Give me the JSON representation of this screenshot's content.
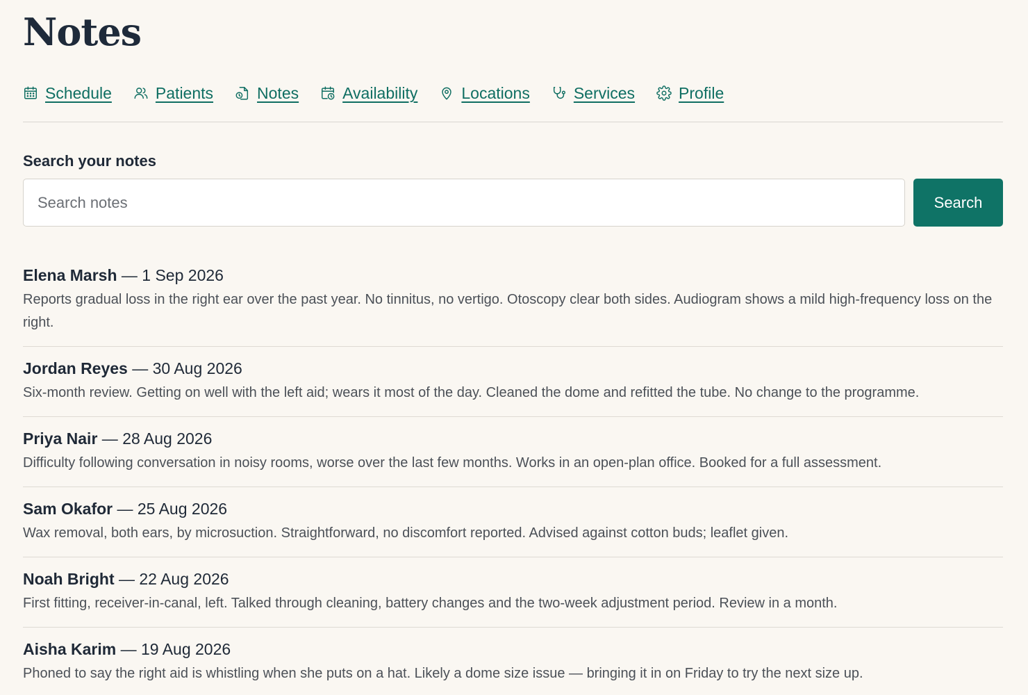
{
  "page": {
    "title": "Notes"
  },
  "nav": {
    "items": [
      {
        "label": "Schedule",
        "icon": "calendar-icon"
      },
      {
        "label": "Patients",
        "icon": "users-icon"
      },
      {
        "label": "Notes",
        "icon": "notes-icon"
      },
      {
        "label": "Availability",
        "icon": "calendar-clock-icon"
      },
      {
        "label": "Locations",
        "icon": "map-pin-icon"
      },
      {
        "label": "Services",
        "icon": "stethoscope-icon"
      },
      {
        "label": "Profile",
        "icon": "gear-icon"
      }
    ],
    "color": "#0f6e62"
  },
  "search": {
    "label": "Search your notes",
    "placeholder": "Search notes",
    "value": "",
    "button_label": "Search",
    "button_color": "#0f7366"
  },
  "notes": [
    {
      "name": "Elena Marsh",
      "date": "1 Sep 2026",
      "body": "Reports gradual loss in the right ear over the past year. No tinnitus, no vertigo. Otoscopy clear both sides. Audiogram shows a mild high-frequency loss on the right."
    },
    {
      "name": "Jordan Reyes",
      "date": "30 Aug 2026",
      "body": "Six-month review. Getting on well with the left aid; wears it most of the day. Cleaned the dome and refitted the tube. No change to the programme."
    },
    {
      "name": "Priya Nair",
      "date": "28 Aug 2026",
      "body": "Difficulty following conversation in noisy rooms, worse over the last few months. Works in an open-plan office. Booked for a full assessment."
    },
    {
      "name": "Sam Okafor",
      "date": "25 Aug 2026",
      "body": "Wax removal, both ears, by microsuction. Straightforward, no discomfort reported. Advised against cotton buds; leaflet given."
    },
    {
      "name": "Noah Bright",
      "date": "22 Aug 2026",
      "body": "First fitting, receiver-in-canal, left. Talked through cleaning, battery changes and the two-week adjustment period. Review in a month."
    },
    {
      "name": "Aisha Karim",
      "date": "19 Aug 2026",
      "body": "Phoned to say the right aid is whistling when she puts on a hat. Likely a dome size issue — bringing it in on Friday to try the next size up."
    }
  ]
}
